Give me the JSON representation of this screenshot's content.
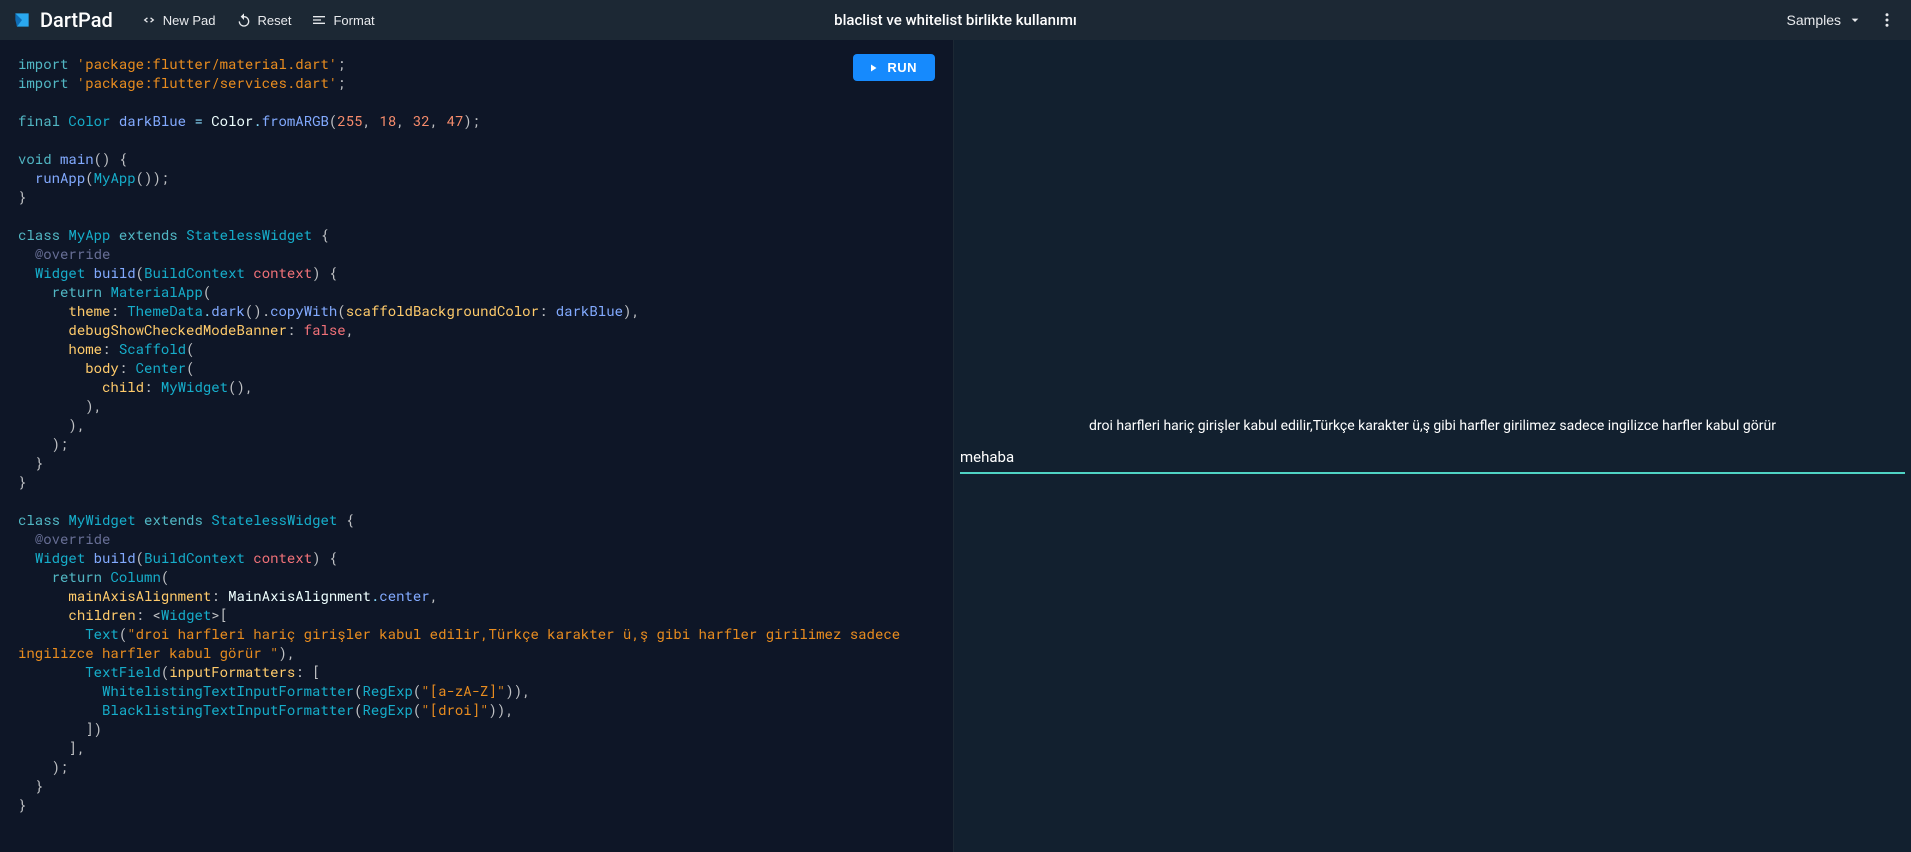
{
  "header": {
    "brand": "DartPad",
    "new_pad": "New Pad",
    "reset": "Reset",
    "format": "Format",
    "title": "blaclist ve whitelist birlikte kullanımı",
    "samples": "Samples"
  },
  "run_label": "RUN",
  "code": {
    "l1_import": "import ",
    "l1_pkg": "'package:flutter/material.dart'",
    "l2_import": "import ",
    "l2_pkg": "'package:flutter/services.dart'",
    "final": "final",
    "color_t": "Color",
    "darkBlue": "darkBlue",
    "eq": " = ",
    "color_c": "Color",
    "dot": ".",
    "fromARGB": "fromARGB",
    "n255": "255",
    "n18": "18",
    "n32": "32",
    "n47": "47",
    "void": "void",
    "main": "main",
    "runApp": "runApp",
    "MyApp": "MyApp",
    "class": "class",
    "extends": "extends",
    "StatelessWidget": "StatelessWidget",
    "override": "@override",
    "Widget": "Widget",
    "build": "build",
    "BuildContext": "BuildContext",
    "context": "context",
    "return": "return",
    "MaterialApp": "MaterialApp",
    "theme": "theme",
    "ThemeData": "ThemeData",
    "dark": "dark",
    "copyWith": "copyWith",
    "scaffoldBackgroundColor": "scaffoldBackgroundColor",
    "debugShowCheckedModeBanner": "debugShowCheckedModeBanner",
    "false": "false",
    "home": "home",
    "Scaffold": "Scaffold",
    "body": "body",
    "Center": "Center",
    "child": "child",
    "MyWidget": "MyWidget",
    "Column": "Column",
    "mainAxisAlignment": "mainAxisAlignment",
    "MainAxisAlignment": "MainAxisAlignment",
    "center": "center",
    "children": "children",
    "WidgetT": "Widget",
    "Text": "Text",
    "text_str1": "\"droi harfleri hariç girişler kabul edilir,Türkçe karakter ü,ş gibi harfler girilimez sadece ",
    "text_str2": "ingilizce harfler kabul görür \"",
    "TextField": "TextField",
    "inputFormatters": "inputFormatters",
    "WhitelistingTextInputFormatter": "WhitelistingTextInputFormatter",
    "BlacklistingTextInputFormatter": "BlacklistingTextInputFormatter",
    "RegExp": "RegExp",
    "regex_az": "\"[a-zA-Z]\"",
    "regex_droi": "\"[droi]\""
  },
  "output": {
    "hint": "droi harfleri hariç girişler kabul edilir,Türkçe karakter ü,ş gibi harfler girilimez sadece ingilizce harfler kabul görür",
    "textfield_value": "mehaba"
  },
  "colors": {
    "run_button": "#168afd",
    "header_bg": "#1c2834",
    "editor_bg": "#0e1627",
    "output_bg": "#12202f",
    "accent_underline": "#4fd3c4"
  }
}
